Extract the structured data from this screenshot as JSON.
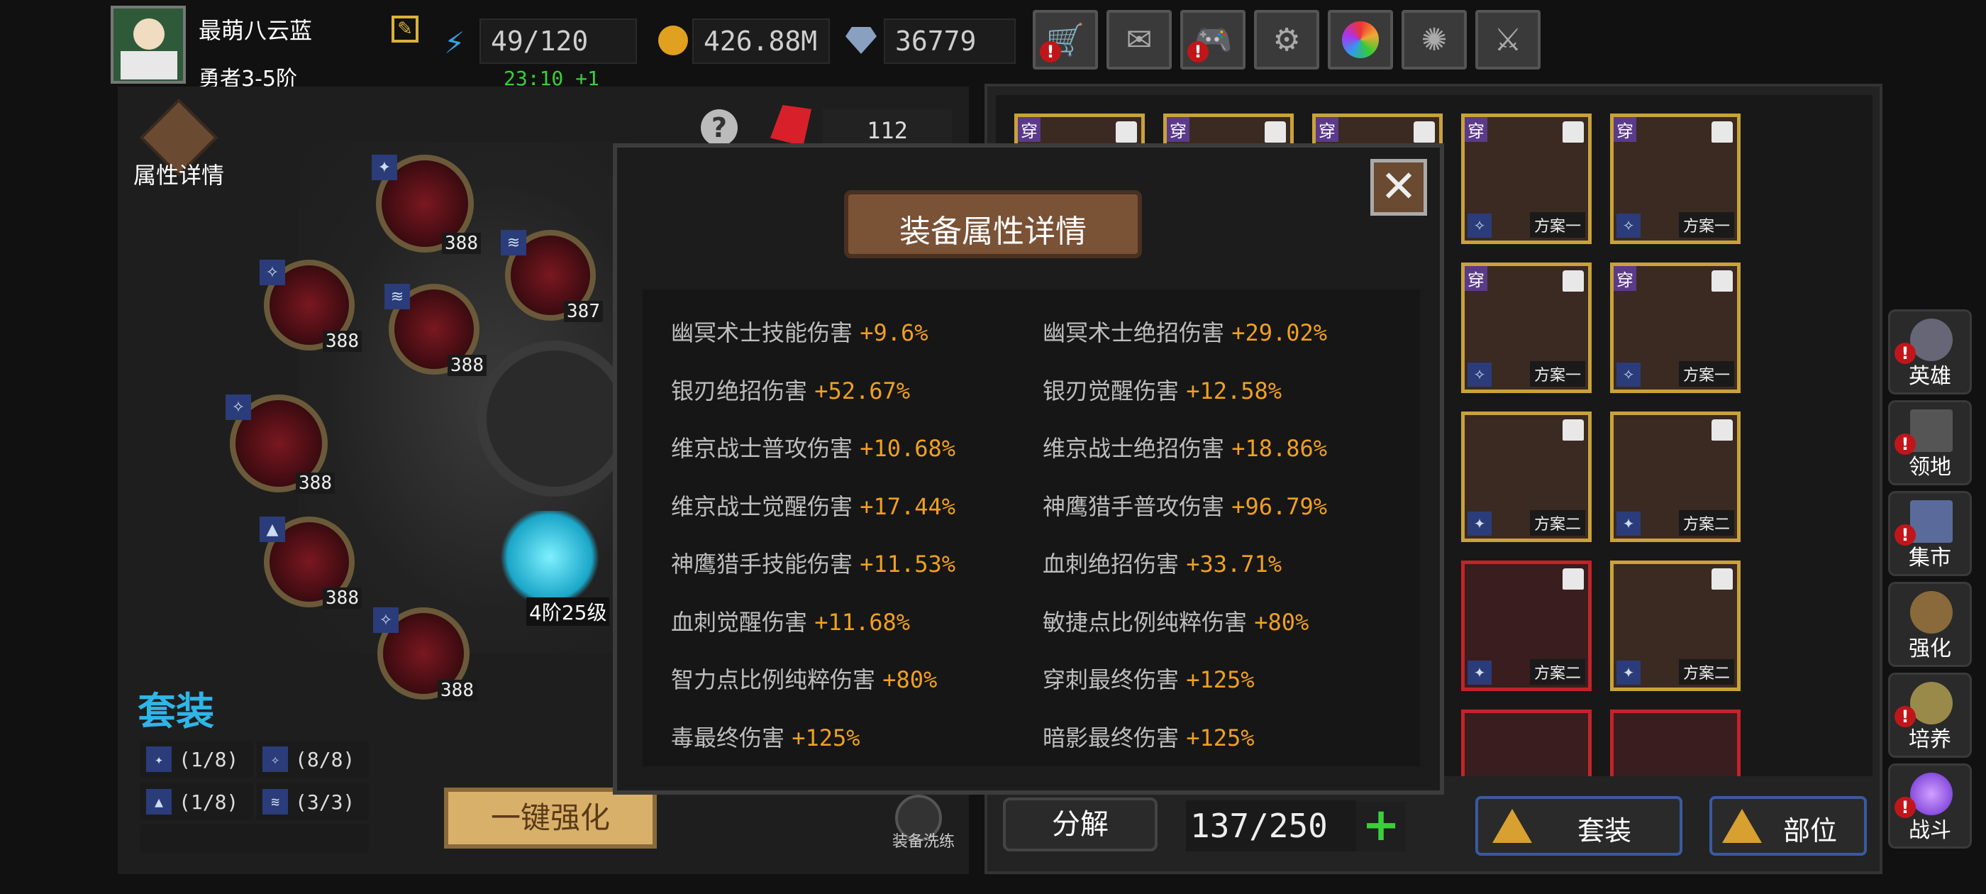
{
  "player": {
    "name": "最萌八云蓝",
    "rank": "勇者3-5阶"
  },
  "resources": {
    "stamina": "49/120",
    "stamina_timer": "23:10 +1",
    "gold": "426.88M",
    "gems": "36779"
  },
  "top_buttons": [
    {
      "icon": "cart-icon",
      "alert": true
    },
    {
      "icon": "mail-icon",
      "alert": false
    },
    {
      "icon": "gamepad-icon",
      "alert": true
    },
    {
      "icon": "gear-icon",
      "alert": false
    },
    {
      "icon": "color-wheel-icon",
      "alert": false
    },
    {
      "icon": "fireworks-icon",
      "alert": false
    },
    {
      "icon": "crossed-swords-icon",
      "alert": false
    }
  ],
  "left_panel": {
    "attr_detail_label": "属性详情",
    "crystal_count": "112",
    "core_level": "4阶25级",
    "node_levels": [
      "388",
      "388",
      "387",
      "388",
      "388",
      "388",
      "388"
    ],
    "set_title": "套装",
    "sets": [
      {
        "icon": "shuriken-icon",
        "count": "(1/8)"
      },
      {
        "icon": "dragon-icon",
        "count": "(8/8)"
      },
      {
        "icon": "mountain-icon",
        "count": "(1/8)"
      },
      {
        "icon": "wave-icon",
        "count": "(3/3)"
      }
    ],
    "upgrade_all": "一键强化",
    "wash_label": "装备洗练"
  },
  "inventory": {
    "decompose": "分解",
    "capacity": "137/250",
    "set_filter": "套装",
    "slot_filter": "部位",
    "wear_tag": "穿",
    "plan1": "方案一",
    "plan2": "方案二"
  },
  "side_nav": [
    {
      "label": "英雄",
      "icon": "helmet-icon"
    },
    {
      "label": "领地",
      "icon": "castle-icon"
    },
    {
      "label": "集市",
      "icon": "market-icon"
    },
    {
      "label": "强化",
      "icon": "forge-icon"
    },
    {
      "label": "培养",
      "icon": "chalice-icon"
    },
    {
      "label": "战斗",
      "icon": "portal-icon"
    }
  ],
  "dialog": {
    "title": "装备属性详情",
    "stats": [
      {
        "name": "幽冥术士技能伤害",
        "value": "+9.6%"
      },
      {
        "name": "幽冥术士绝招伤害",
        "value": "+29.02%"
      },
      {
        "name": "银刃绝招伤害",
        "value": "+52.67%"
      },
      {
        "name": "银刃觉醒伤害",
        "value": "+12.58%"
      },
      {
        "name": "维京战士普攻伤害",
        "value": "+10.68%"
      },
      {
        "name": "维京战士绝招伤害",
        "value": "+18.86%"
      },
      {
        "name": "维京战士觉醒伤害",
        "value": "+17.44%"
      },
      {
        "name": "神鹰猎手普攻伤害",
        "value": "+96.79%"
      },
      {
        "name": "神鹰猎手技能伤害",
        "value": "+11.53%"
      },
      {
        "name": "血刺绝招伤害",
        "value": "+33.71%"
      },
      {
        "name": "血刺觉醒伤害",
        "value": "+11.68%"
      },
      {
        "name": "敏捷点比例纯粹伤害",
        "value": "+80%"
      },
      {
        "name": "智力点比例纯粹伤害",
        "value": "+80%"
      },
      {
        "name": "穿刺最终伤害",
        "value": "+125%"
      },
      {
        "name": "毒最终伤害",
        "value": "+125%"
      },
      {
        "name": "暗影最终伤害",
        "value": "+125%"
      }
    ]
  },
  "colors": {
    "accent": "#f0a020",
    "set_title": "#2fb6e8",
    "dialog_bg": "#1c1c1c"
  }
}
